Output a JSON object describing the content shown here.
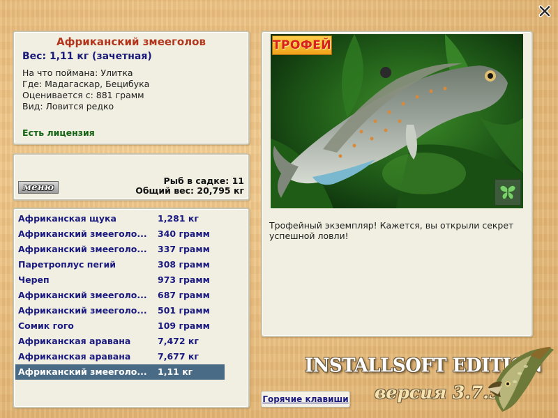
{
  "close": {
    "icon": "close-icon"
  },
  "info": {
    "title": "Африканский змееголов",
    "weight": "Вес: 1,11 кг (зачетная)",
    "bait": "На что поймана: Улитка",
    "location": "Где: Мадагаскар, Бецибука",
    "threshold": "Оценивается с: 881 грамм",
    "kind": "Вид: Ловится редко",
    "license": "Есть лицензия"
  },
  "cage": {
    "menu_label": "меню",
    "count": "Рыб в садке: 11",
    "total": "Общий вес: 20,795 кг"
  },
  "catches": [
    {
      "name": "Африканская щука",
      "weight": "1,281 кг"
    },
    {
      "name": "Африканский змееголо...",
      "weight": "340 грамм"
    },
    {
      "name": "Африканский змееголо...",
      "weight": "337 грамм"
    },
    {
      "name": "Паретроплус пегий",
      "weight": "308 грамм"
    },
    {
      "name": "Череп",
      "weight": "973 грамм"
    },
    {
      "name": "Африканский змееголо...",
      "weight": "687 грамм"
    },
    {
      "name": "Африканский змееголо...",
      "weight": "501 грамм"
    },
    {
      "name": "Сомик гого",
      "weight": "109 грамм"
    },
    {
      "name": "Африканская аравана",
      "weight": "7,472 кг"
    },
    {
      "name": "Африканская аравана",
      "weight": "7,677 кг"
    },
    {
      "name": "Африканский змееголо...",
      "weight": "1,11 кг"
    }
  ],
  "selected_index": 10,
  "photo": {
    "trophy_label": "ТРОФЕЙ",
    "description": "Трофейный экземпляр! Кажется, вы открыли секрет успешной ловли!",
    "icons": [
      "fish-icon",
      "butterfly-icon"
    ]
  },
  "footer": {
    "hotkeys": "Горячие клавиши",
    "brand": "INSTALLSOFT EDITION",
    "version": "версия 3.7.5",
    "icons": [
      "pike-icon"
    ]
  },
  "colors": {
    "title": "#b3361c",
    "link_text": "#1a1a80",
    "license": "#146414",
    "selection": "#4a6b85"
  }
}
